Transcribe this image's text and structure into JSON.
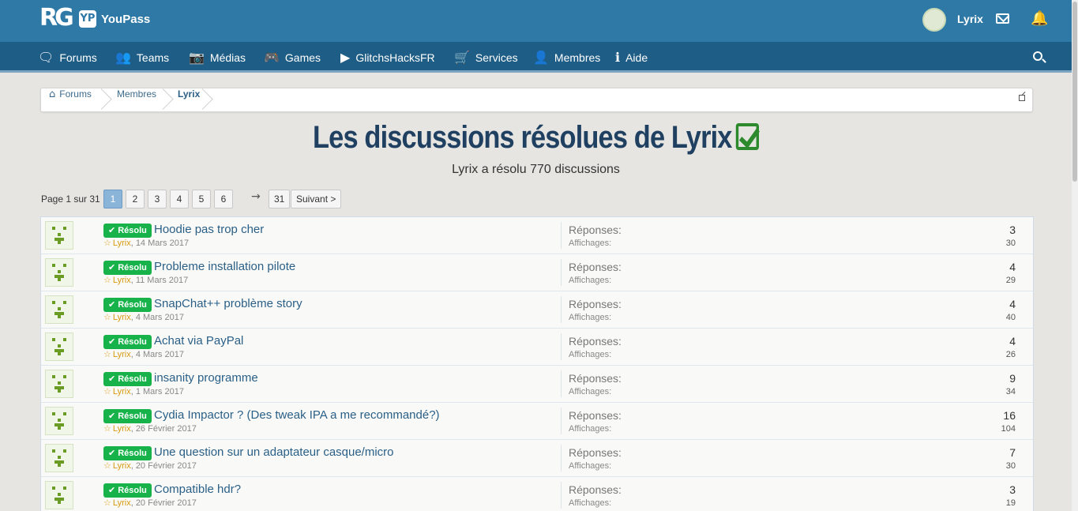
{
  "header": {
    "logo_text": "RG",
    "youpass_badge": "YP",
    "youpass_label": "YouPass",
    "user_name": "Lyrix"
  },
  "nav": {
    "items": [
      {
        "label": "Forums",
        "icon": "comments-icon"
      },
      {
        "label": "Teams",
        "icon": "users-icon"
      },
      {
        "label": "Médias",
        "icon": "camera-icon"
      },
      {
        "label": "Games",
        "icon": "gamepad-icon"
      },
      {
        "label": "GlitchsHacksFR",
        "icon": "youtube-icon"
      },
      {
        "label": "Services",
        "icon": "cart-icon"
      },
      {
        "label": "Membres",
        "icon": "user-icon"
      },
      {
        "label": "Aide",
        "icon": "info-icon"
      }
    ]
  },
  "breadcrumb": {
    "items": [
      "Forums",
      "Membres",
      "Lyrix"
    ]
  },
  "page": {
    "title": "Les discussions résolues de Lyrix",
    "subtitle": "Lyrix a résolu 770 discussions"
  },
  "pager": {
    "label": "Page 1 sur 31",
    "pages": [
      "1",
      "2",
      "3",
      "4",
      "5",
      "6"
    ],
    "last": "31",
    "next": "Suivant >",
    "current": 1
  },
  "threads": {
    "badge_label": "Résolu",
    "replies_label": "Réponses:",
    "views_label": "Affichages:",
    "rows": [
      {
        "title": "Hoodie pas trop cher",
        "author": "Lyrix",
        "date": ", 14 Mars 2017",
        "replies": "3",
        "views": "30"
      },
      {
        "title": "Probleme installation pilote",
        "author": "Lyrix",
        "date": ", 11 Mars 2017",
        "replies": "4",
        "views": "29"
      },
      {
        "title": "SnapChat++ problème story",
        "author": "Lyrix",
        "date": ", 4 Mars 2017",
        "replies": "4",
        "views": "40"
      },
      {
        "title": "Achat via PayPal",
        "author": "Lyrix",
        "date": ", 4 Mars 2017",
        "replies": "4",
        "views": "26"
      },
      {
        "title": "insanity programme",
        "author": "Lyrix",
        "date": ", 1 Mars 2017",
        "replies": "9",
        "views": "34"
      },
      {
        "title": "Cydia Impactor ? (Des tweak IPA a me recommandé?)",
        "author": "Lyrix",
        "date": ", 26 Février 2017",
        "replies": "16",
        "views": "104"
      },
      {
        "title": "Une question sur un adaptateur casque/micro",
        "author": "Lyrix",
        "date": ", 20 Février 2017",
        "replies": "7",
        "views": "30"
      },
      {
        "title": "Compatible hdr?",
        "author": "Lyrix",
        "date": ", 20 Février 2017",
        "replies": "3",
        "views": "19"
      }
    ]
  }
}
